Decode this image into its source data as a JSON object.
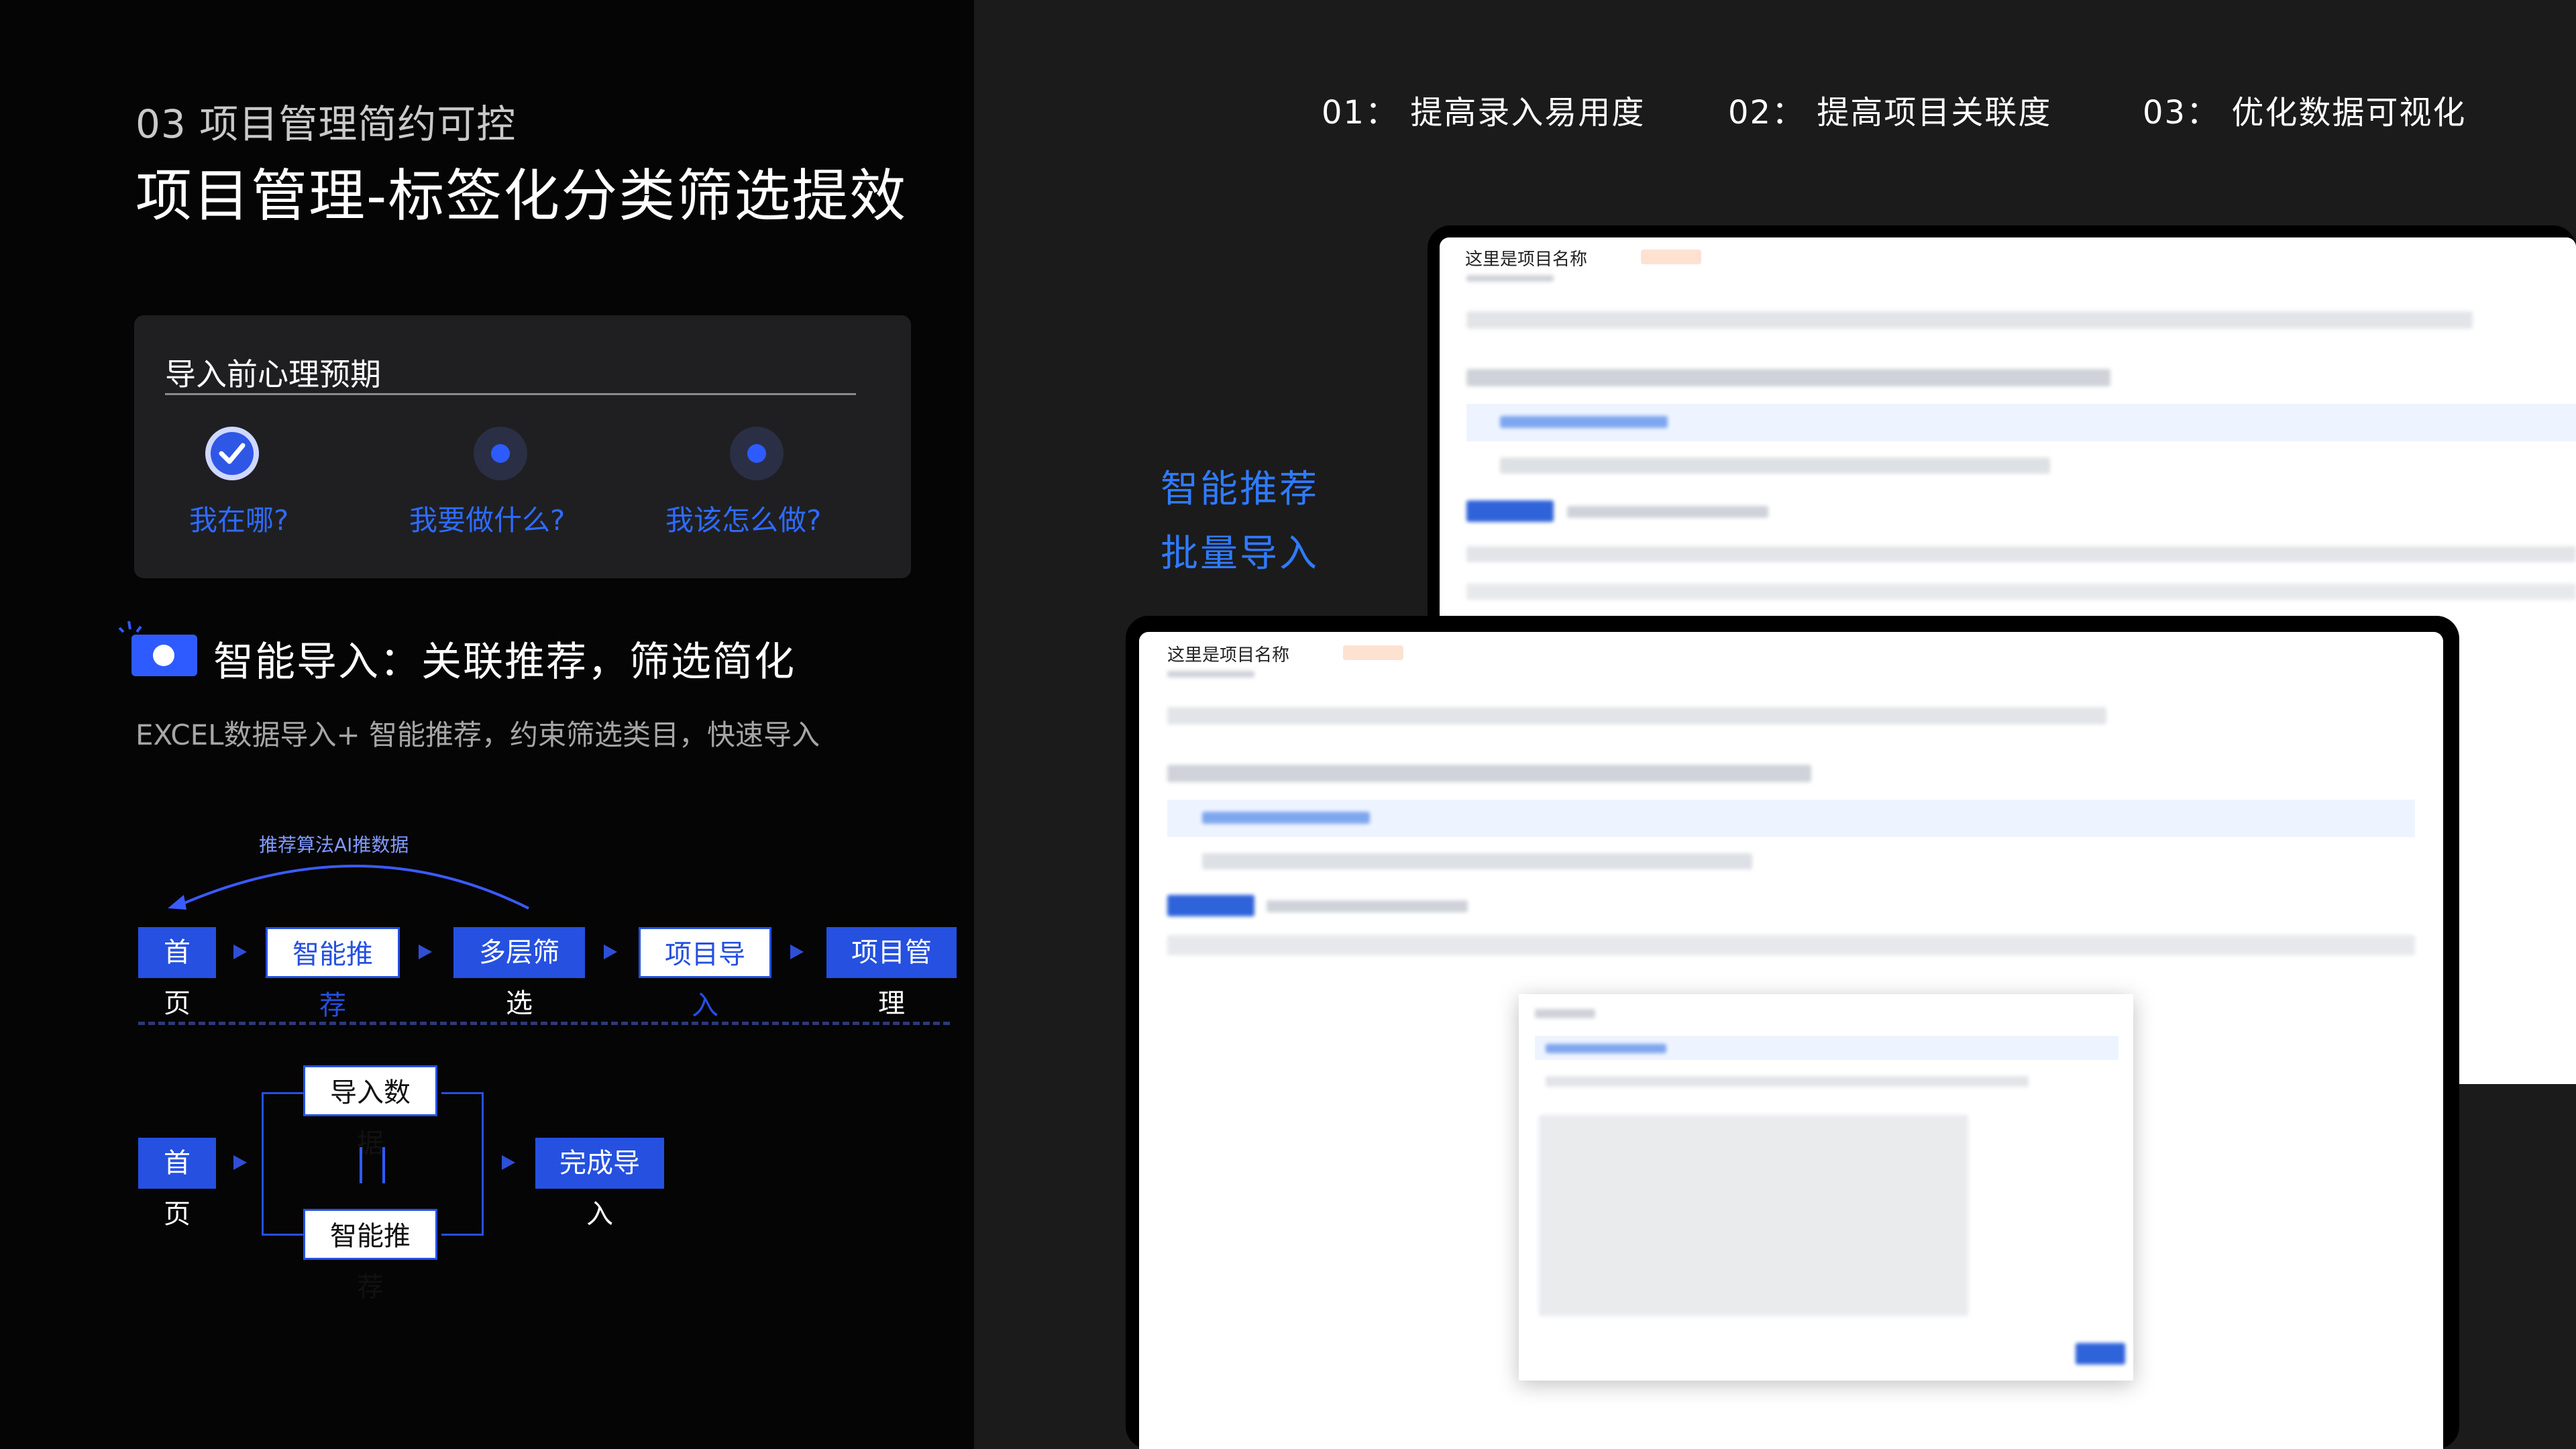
{
  "header": {
    "subtitle": "03 项目管理简约可控",
    "title": "项目管理-标签化分类筛选提效"
  },
  "expectation": {
    "heading": "导入前心理预期",
    "items": [
      {
        "label": "我在哪?",
        "state": "done"
      },
      {
        "label": "我要做什么?",
        "state": "pending"
      },
      {
        "label": "我该怎么做?",
        "state": "pending"
      }
    ]
  },
  "feature": {
    "title": "智能导入：关联推荐，筛选简化",
    "desc": "EXCEL数据导入+ 智能推荐，约束筛选类目，快速导入"
  },
  "flow1": {
    "ai_label": "推荐算法AI推数据",
    "steps": [
      "首页",
      "智能推荐",
      "多层筛选",
      "项目导入",
      "项目管理"
    ]
  },
  "flow2": {
    "start": "首页",
    "branch_top": "导入数据",
    "branch_bottom": "智能推荐",
    "end": "完成导入"
  },
  "goals": [
    {
      "num": "01：",
      "text": "提高录入易用度"
    },
    {
      "num": "02：",
      "text": "提高项目关联度"
    },
    {
      "num": "03：",
      "text": "优化数据可视化"
    }
  ],
  "side_labels": [
    "智能推荐",
    "批量导入"
  ],
  "devices": {
    "back_title": "这里是项目名称",
    "front_title": "这里是项目名称"
  },
  "colors": {
    "accent": "#2550e0",
    "accent_text": "#2e6bff",
    "left_bg": "#050505",
    "right_bg": "#1b1b1c"
  }
}
